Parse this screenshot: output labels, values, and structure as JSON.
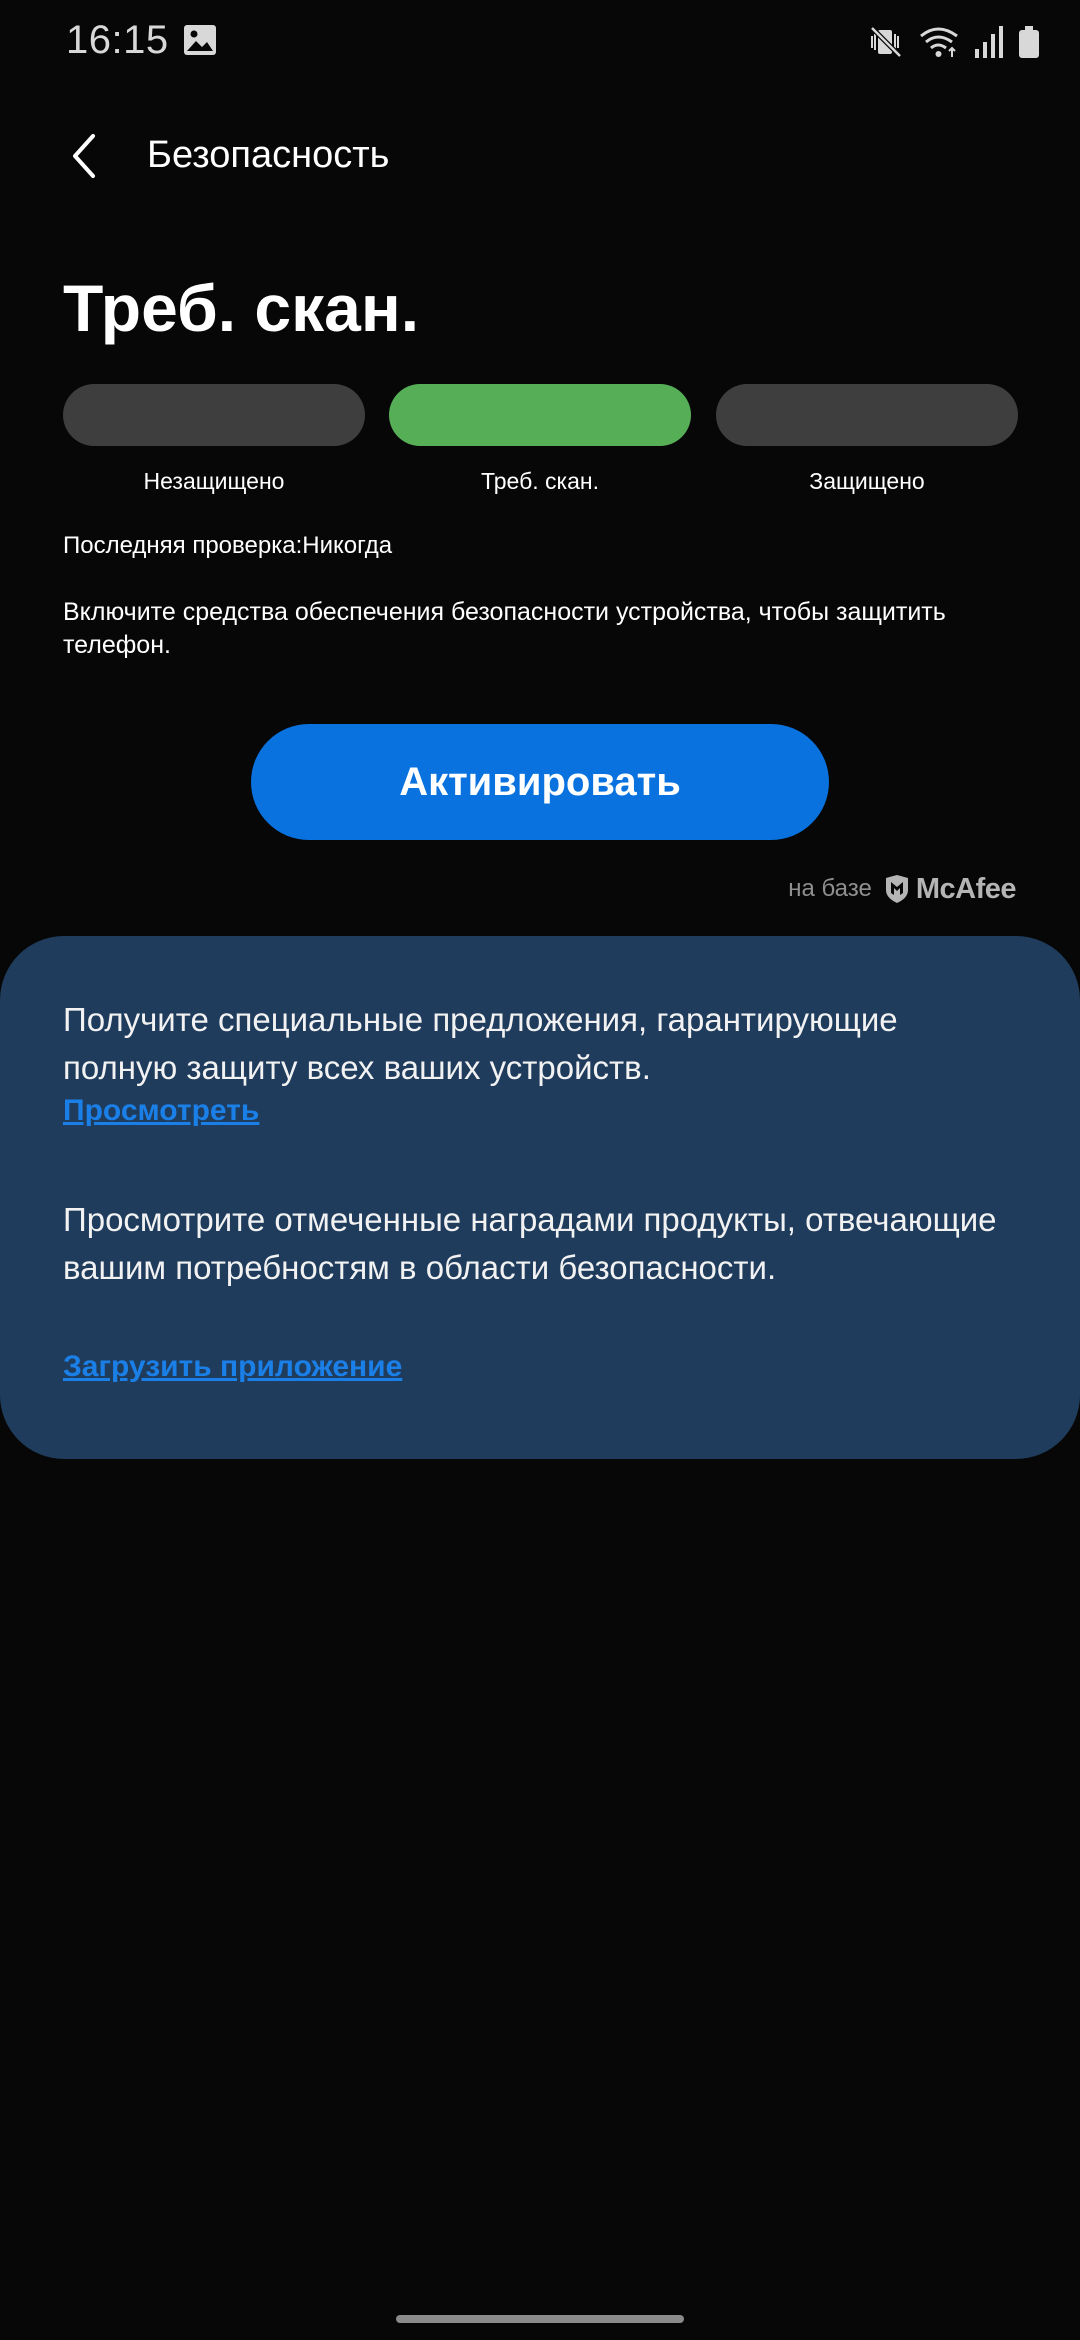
{
  "status_bar": {
    "time": "16:15",
    "icons": [
      "gallery-icon",
      "mute-vibrate-icon",
      "wifi-icon",
      "signal-icon",
      "battery-icon"
    ]
  },
  "header": {
    "title": "Безопасность",
    "back_icon": "chevron-left-icon"
  },
  "security_status": {
    "title": "Треб. скан.",
    "levels": [
      {
        "label": "Незащищено",
        "active": false
      },
      {
        "label": "Треб. скан.",
        "active": true
      },
      {
        "label": "Защищено",
        "active": false
      }
    ],
    "last_check": "Последняя проверка:Никогда",
    "description": "Включите средства обеспечения безопасности устройства, чтобы защитить телефон.",
    "activate_label": "Активировать"
  },
  "powered_by": {
    "label": "на базе",
    "brand": "McAfee"
  },
  "offers": {
    "offer1_text": "Получите специальные предложения, гарантирующие полную защиту всех ваших устройств.",
    "offer1_link": "Просмотреть",
    "offer2_text": "Просмотрите отмеченные наградами продукты, отвечающие вашим потребностям в области безопасности.",
    "offer2_link": "Загрузить приложение"
  },
  "colors": {
    "background": "#070707",
    "pill_inactive": "#3e3e3e",
    "pill_active": "#56ae56",
    "accent_button": "#0972df",
    "card": "#1f3c5d",
    "link": "#1b7fe8"
  }
}
